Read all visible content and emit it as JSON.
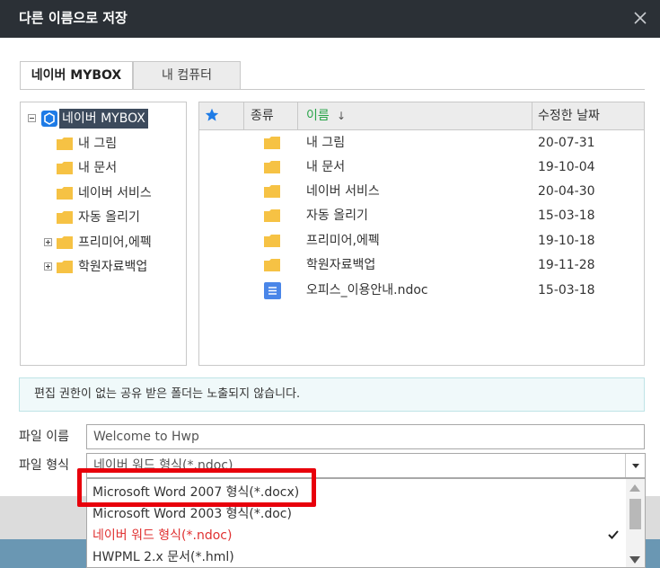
{
  "dialog": {
    "title": "다른 이름으로 저장"
  },
  "tabs": [
    {
      "label": "네이버 MYBOX",
      "active": true
    },
    {
      "label": "내 컴퓨터",
      "active": false
    }
  ],
  "tree": {
    "root": {
      "label": "네이버 MYBOX",
      "icon": "mybox-icon"
    },
    "items": [
      {
        "label": "내 그림",
        "expandable": false
      },
      {
        "label": "내 문서",
        "expandable": false
      },
      {
        "label": "네이버 서비스",
        "expandable": false
      },
      {
        "label": "자동 올리기",
        "expandable": false
      },
      {
        "label": "프리미어,에펙",
        "expandable": true
      },
      {
        "label": "학원자료백업",
        "expandable": true
      }
    ]
  },
  "filelist": {
    "columns": {
      "favorite_icon": "star-icon",
      "type": "종류",
      "name": "이름",
      "sort_indicator": "↓",
      "modified": "수정한 날짜"
    },
    "rows": [
      {
        "icon": "folder-icon",
        "name": "내 그림",
        "date": "20-07-31"
      },
      {
        "icon": "folder-icon",
        "name": "내 문서",
        "date": "19-10-04"
      },
      {
        "icon": "folder-icon",
        "name": "네이버 서비스",
        "date": "20-04-30"
      },
      {
        "icon": "folder-icon",
        "name": "자동 올리기",
        "date": "15-03-18"
      },
      {
        "icon": "folder-icon",
        "name": "프리미어,에펙",
        "date": "19-10-18"
      },
      {
        "icon": "folder-icon",
        "name": "학원자료백업",
        "date": "19-11-28"
      },
      {
        "icon": "document-icon",
        "name": "오피스_이용안내.ndoc",
        "date": "15-03-18"
      }
    ]
  },
  "notice": {
    "text": "편집 권한이 없는 공유 받은 폴더는 노출되지 않습니다."
  },
  "form": {
    "filename_label": "파일 이름",
    "filename_value": "Welcome to Hwp",
    "filetype_label": "파일 형식",
    "filetype_value": "네이버 워드 형식(*.ndoc)"
  },
  "dropdown": {
    "options": [
      {
        "label": "Microsoft Word 2007 형식(*.docx)",
        "highlighted": true
      },
      {
        "label": "Microsoft Word 2003 형식(*.doc)"
      },
      {
        "label": "네이버 워드 형식(*.ndoc)",
        "current": true,
        "checked": true
      },
      {
        "label": "HWPML 2.x 문서(*.hml)"
      }
    ]
  },
  "colors": {
    "titlebar": "#2b3036",
    "accent_green": "#2aa44a",
    "highlight_red": "#e8000b",
    "current_option_red": "#e03131",
    "folder_yellow": "#f6c244",
    "doc_blue": "#4a86e8",
    "star_blue": "#1e7be6"
  }
}
